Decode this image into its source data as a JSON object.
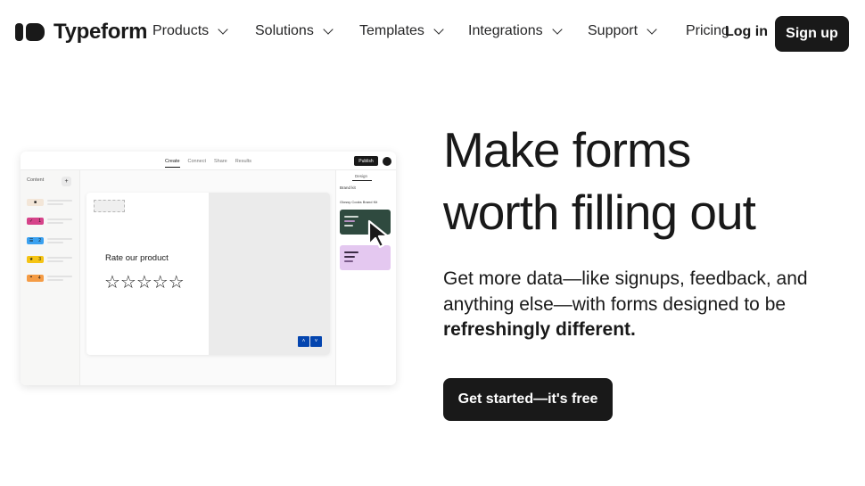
{
  "brand": {
    "name": "Typeform"
  },
  "nav": {
    "items": [
      {
        "label": "Products",
        "has_dropdown": true
      },
      {
        "label": "Solutions",
        "has_dropdown": true
      },
      {
        "label": "Templates",
        "has_dropdown": true
      },
      {
        "label": "Integrations",
        "has_dropdown": true
      },
      {
        "label": "Support",
        "has_dropdown": true
      },
      {
        "label": "Pricing",
        "has_dropdown": false
      }
    ],
    "login_label": "Log in",
    "signup_label": "Sign up"
  },
  "hero": {
    "title_line1": "Make forms",
    "title_line2": "worth filling out",
    "subtitle_plain": "Get more data—like signups, feedback, and anything else—with forms designed to be ",
    "subtitle_bold": "refreshingly different.",
    "cta_label": "Get started—it's free"
  },
  "mockup": {
    "tabs": [
      "Create",
      "Connect",
      "Share",
      "Results"
    ],
    "active_tab": "Create",
    "publish_label": "Publish",
    "content_label": "Content",
    "add_label": "+",
    "questions": [
      {
        "icon": "■",
        "number": "",
        "color": "#f3e6d8"
      },
      {
        "icon": "✓",
        "number": "1",
        "color": "#d6438a"
      },
      {
        "icon": "☰",
        "number": "2",
        "color": "#3aa1f0"
      },
      {
        "icon": "★",
        "number": "3",
        "color": "#f5c414"
      },
      {
        "icon": "❝",
        "number": "4",
        "color": "#f59c45"
      }
    ],
    "question_text": "Rate our product",
    "stars": "☆☆☆☆☆",
    "nav_up": "˄",
    "nav_down": "˅",
    "design_tab": "Design",
    "brand_kit_label": "Brand kit",
    "theme_name": "Glossy Cooks Brand Kit",
    "colors": {
      "theme_dark": "#2f4a3f",
      "theme_light": "#e4c8f0",
      "accent": "#0445af"
    }
  }
}
